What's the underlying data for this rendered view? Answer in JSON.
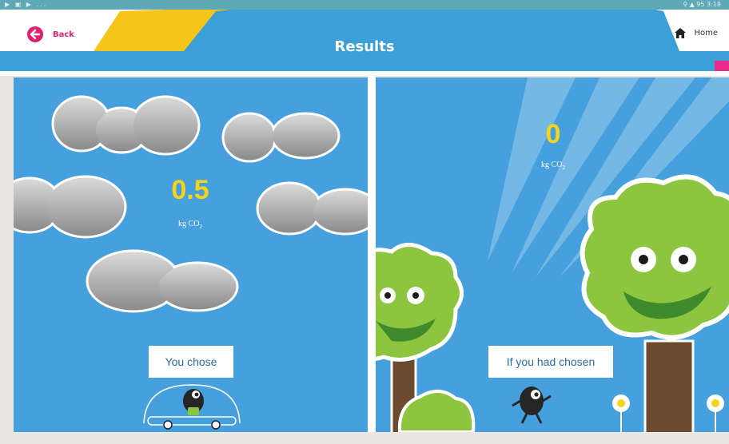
{
  "status_bar": {
    "left_icons": "▶ ▣ ▶ ...",
    "right_text": "⚲ ▲ 95 3:18"
  },
  "header": {
    "title": "Results",
    "back_label": "Back",
    "home_label": "Home"
  },
  "left_panel": {
    "value": "0.5",
    "unit_prefix": "kg CO",
    "unit_sub": "2",
    "label": "You chose"
  },
  "right_panel": {
    "value": "0",
    "unit_prefix": "kg CO",
    "unit_sub": "2",
    "label": "If you had chosen"
  },
  "colors": {
    "sky_blue": "#46a0dd",
    "header_blue": "#3c9fd8",
    "accent_pink": "#e2206f",
    "value_yellow": "#f7d41c",
    "tree_green": "#8cc63f",
    "cloud_grey": "#9a9a9a"
  },
  "icons": {
    "back": "arrow-left-circle-icon",
    "home": "house-icon"
  }
}
